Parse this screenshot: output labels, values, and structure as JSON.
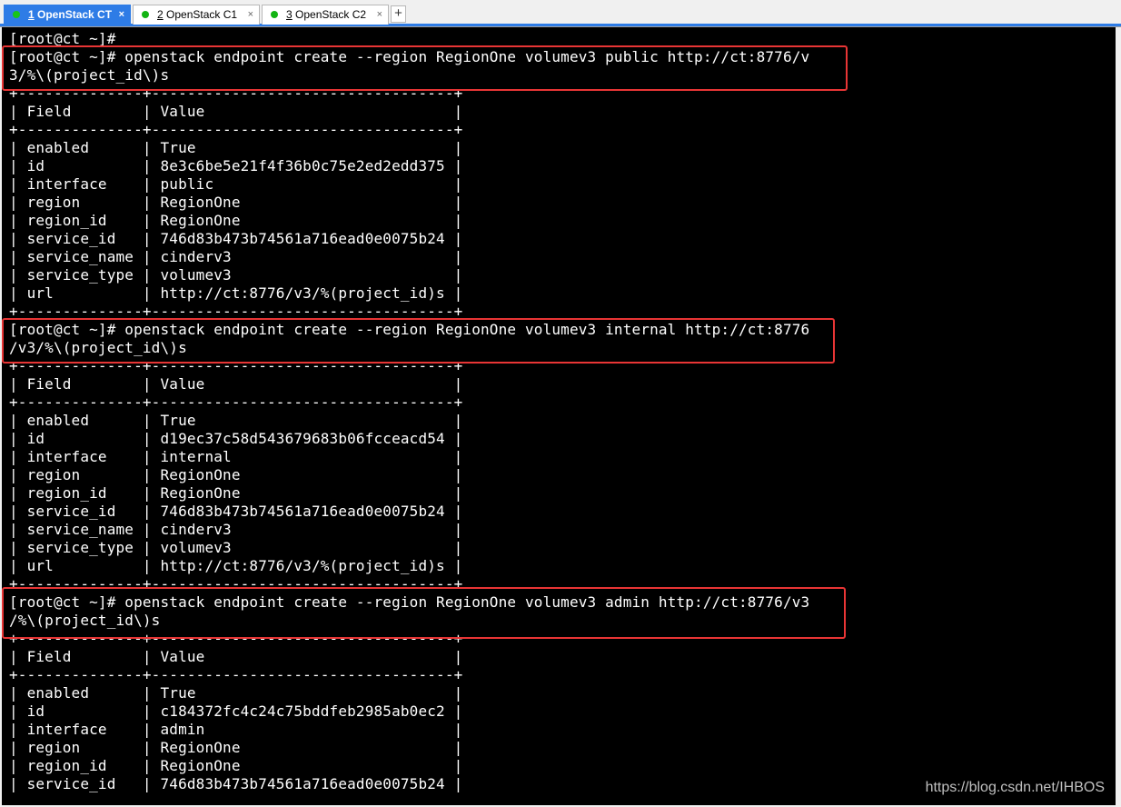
{
  "tabs": [
    {
      "num": "1",
      "title": " OpenStack CT",
      "active": true,
      "close": "×"
    },
    {
      "num": "2",
      "title": " OpenStack C1",
      "active": false,
      "close": "×"
    },
    {
      "num": "3",
      "title": " OpenStack C2",
      "active": false,
      "close": "×"
    }
  ],
  "add_tab": "+",
  "terminal": {
    "lines": [
      "[root@ct ~]#",
      "[root@ct ~]# openstack endpoint create --region RegionOne volumev3 public http://ct:8776/v",
      "3/%\\(project_id\\)s",
      "+--------------+----------------------------------+",
      "| Field        | Value                            |",
      "+--------------+----------------------------------+",
      "| enabled      | True                             |",
      "| id           | 8e3c6be5e21f4f36b0c75e2ed2edd375 |",
      "| interface    | public                           |",
      "| region       | RegionOne                        |",
      "| region_id    | RegionOne                        |",
      "| service_id   | 746d83b473b74561a716ead0e0075b24 |",
      "| service_name | cinderv3                         |",
      "| service_type | volumev3                         |",
      "| url          | http://ct:8776/v3/%(project_id)s |",
      "+--------------+----------------------------------+",
      "[root@ct ~]# openstack endpoint create --region RegionOne volumev3 internal http://ct:8776",
      "/v3/%\\(project_id\\)s",
      "+--------------+----------------------------------+",
      "| Field        | Value                            |",
      "+--------------+----------------------------------+",
      "| enabled      | True                             |",
      "| id           | d19ec37c58d543679683b06fcceacd54 |",
      "| interface    | internal                         |",
      "| region       | RegionOne                        |",
      "| region_id    | RegionOne                        |",
      "| service_id   | 746d83b473b74561a716ead0e0075b24 |",
      "| service_name | cinderv3                         |",
      "| service_type | volumev3                         |",
      "| url          | http://ct:8776/v3/%(project_id)s |",
      "+--------------+----------------------------------+",
      "[root@ct ~]# openstack endpoint create --region RegionOne volumev3 admin http://ct:8776/v3",
      "/%\\(project_id\\)s",
      "+--------------+----------------------------------+",
      "| Field        | Value                            |",
      "+--------------+----------------------------------+",
      "| enabled      | True                             |",
      "| id           | c184372fc4c24c75bddfeb2985ab0ec2 |",
      "| interface    | admin                            |",
      "| region       | RegionOne                        |",
      "| region_id    | RegionOne                        |",
      "| service_id   | 746d83b473b74561a716ead0e0075b24 |"
    ]
  },
  "watermark": "https://blog.csdn.net/IHBOS",
  "colors": {
    "terminal_bg": "#000000",
    "terminal_fg": "#ffffff",
    "highlight": "#e83535",
    "active_tab": "#2e7ce6",
    "status_dot": "#12b312"
  }
}
